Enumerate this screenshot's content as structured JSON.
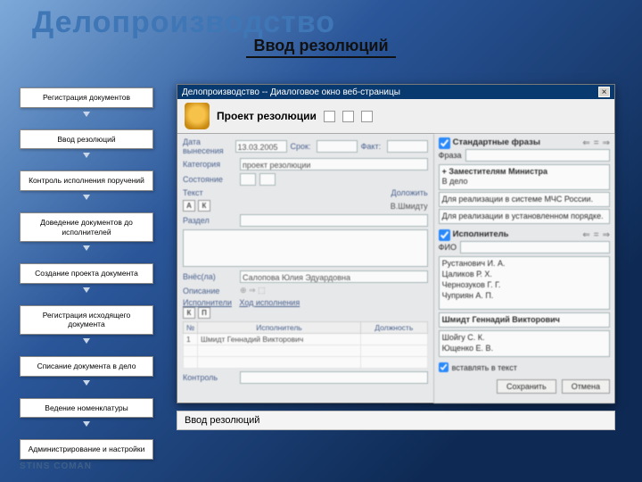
{
  "page": {
    "title": "Делопроизводство",
    "subtitle": "Ввод резолюций"
  },
  "sidebar": {
    "items": [
      {
        "label": "Регистрация документов"
      },
      {
        "label": "Ввод резолюций"
      },
      {
        "label": "Контроль исполнения поручений"
      },
      {
        "label": "Доведение документов до исполнителей"
      },
      {
        "label": "Создание проекта документа"
      },
      {
        "label": "Регистрация исходящего документа"
      },
      {
        "label": "Списание документа в дело"
      },
      {
        "label": "Ведение номенклатуры"
      },
      {
        "label": "Администрирование и настройки"
      }
    ]
  },
  "dialog": {
    "window_title": "Делопроизводство -- Диалоговое окно веб-страницы",
    "title": "Проект резолюции",
    "tabs": {
      "a": "А",
      "k": "К"
    },
    "fields": {
      "date_label": "Дата вынесения",
      "date": "13.03.2005",
      "deadline_label": "Срок:",
      "fact_label": "Факт:",
      "category_label": "Категория",
      "category": "проект резолюции",
      "state_label": "Состояние",
      "text_label": "Текст",
      "text_btn": "Доложить",
      "assignee": "В.Шмидту",
      "section_label": "Раздел",
      "author_label": "Внёс(ла)",
      "author_value": "Салопова Юлия Эдуардовна",
      "description_label": "Описание",
      "controller_label": "Контроль",
      "exec_tab1": "Исполнители",
      "exec_tab2": "Ход исполнения",
      "th_num": "№",
      "th_exec": "Исполнитель",
      "th_post": "Должность",
      "row_num": "1",
      "row_name": "Шмидт Геннадий Викторович",
      "kp_k": "К",
      "kp_p": "П"
    },
    "right": {
      "std_label": "Стандартные фразы",
      "phrase_label": "Фраза",
      "phrase1_title": "+ Заместителям Министра",
      "phrase1_sub": "В дело",
      "phrase2": "Для реализации в системе МЧС России.",
      "phrase3": "Для реализации в установленном порядке.",
      "exec_label": "Исполнитель",
      "fio_label": "ФИО",
      "names": [
        "Рустанович И. А.",
        "Цаликов Р. Х.",
        "Чернозуков Г. Г.",
        "Чуприян А. П.",
        "Шмидт Геннадий Викторович",
        "Шойгу С. К.",
        "Ющенко Е. В."
      ],
      "insert_label": "вставлять в текст",
      "save": "Сохранить",
      "cancel": "Отмена"
    }
  },
  "caption": "Ввод резолюций",
  "logo": "STINS COMAN"
}
